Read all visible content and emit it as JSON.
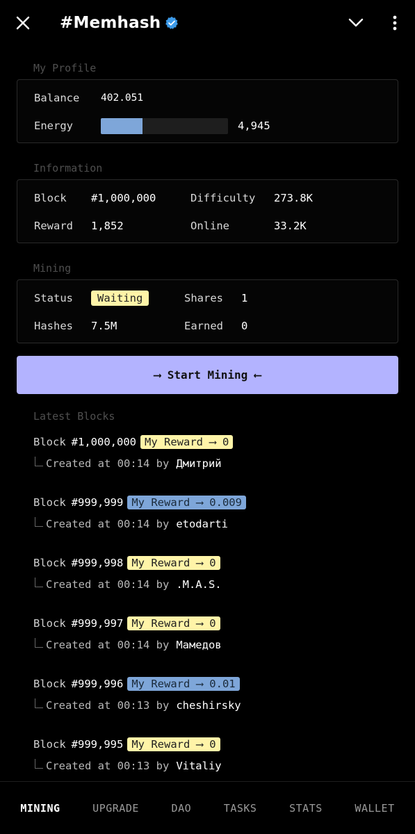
{
  "header": {
    "title": "#Memhash",
    "close_icon": "close-icon",
    "verified_icon": "verified-badge-icon",
    "chevron_icon": "chevron-down-icon",
    "menu_icon": "more-vertical-icon",
    "accent_color": "#3d9be9"
  },
  "profile": {
    "section_label": "My Profile",
    "balance_label": "Balance",
    "balance_value": "402.051",
    "energy_label": "Energy",
    "energy_value": "4,945",
    "energy_fraction": 0.33
  },
  "information": {
    "section_label": "Information",
    "block_label": "Block",
    "block_value": "#1,000,000",
    "difficulty_label": "Difficulty",
    "difficulty_value": "273.8K",
    "reward_label": "Reward",
    "reward_value": "1,852",
    "online_label": "Online",
    "online_value": "33.2K"
  },
  "mining": {
    "section_label": "Mining",
    "status_label": "Status",
    "status_value": "Waiting",
    "shares_label": "Shares",
    "shares_value": "1",
    "hashes_label": "Hashes",
    "hashes_value": "7.5M",
    "earned_label": "Earned",
    "earned_value": "0",
    "start_button": "⟶ Start Mining ⟵"
  },
  "latest_blocks": {
    "section_label": "Latest Blocks",
    "items": [
      {
        "label": "Block",
        "number": "#1,000,000",
        "reward": "My Reward ⟶ 0",
        "style": "yellow",
        "created": "Created at 00:14 by",
        "user": "Дмитрий"
      },
      {
        "label": "Block",
        "number": "#999,999",
        "reward": "My Reward ⟶ 0.009",
        "style": "blue",
        "created": "Created at 00:14 by",
        "user": "etodarti"
      },
      {
        "label": "Block",
        "number": "#999,998",
        "reward": "My Reward ⟶ 0",
        "style": "yellow",
        "created": "Created at 00:14 by",
        "user": ".M.A.S."
      },
      {
        "label": "Block",
        "number": "#999,997",
        "reward": "My Reward ⟶ 0",
        "style": "yellow",
        "created": "Created at 00:14 by",
        "user": "Мамедов"
      },
      {
        "label": "Block",
        "number": "#999,996",
        "reward": "My Reward ⟶ 0.01",
        "style": "blue",
        "created": "Created at 00:13 by",
        "user": "cheshirsky"
      },
      {
        "label": "Block",
        "number": "#999,995",
        "reward": "My Reward ⟶ 0",
        "style": "yellow",
        "created": "Created at 00:13 by",
        "user": "Vitaliy"
      }
    ]
  },
  "nav": {
    "items": [
      "MINING",
      "UPGRADE",
      "DAO",
      "TASKS",
      "STATS",
      "WALLET"
    ],
    "active": "MINING"
  }
}
